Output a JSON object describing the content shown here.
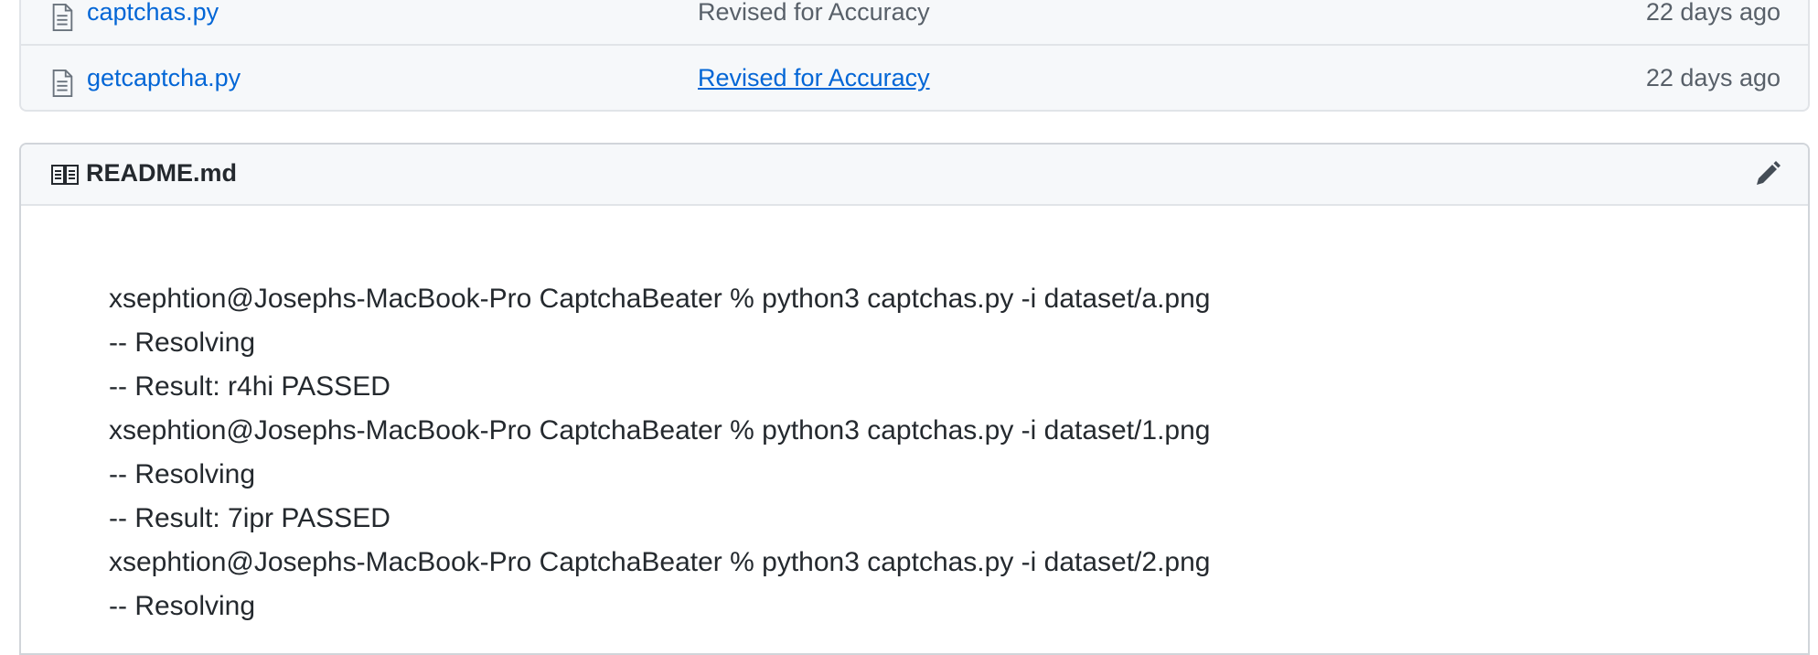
{
  "files": [
    {
      "name": "captchas.py",
      "icon": "file-icon",
      "commit_message": "Revised for Accuracy",
      "age": "22 days ago"
    },
    {
      "name": "getcaptcha.py",
      "icon": "file-icon",
      "commit_message": "Revised for Accuracy",
      "age": "22 days ago"
    }
  ],
  "readme": {
    "title": "README.md",
    "icon": "book-icon",
    "edit_icon": "pencil-icon",
    "lines": [
      "xsephtion@Josephs-MacBook-Pro CaptchaBeater % python3 captchas.py -i dataset/a.png",
      "-- Resolving",
      "-- Result: r4hi PASSED",
      "xsephtion@Josephs-MacBook-Pro CaptchaBeater % python3 captchas.py -i dataset/1.png",
      "-- Resolving",
      "-- Result: 7ipr PASSED",
      "xsephtion@Josephs-MacBook-Pro CaptchaBeater % python3 captchas.py -i dataset/2.png",
      "-- Resolving"
    ]
  },
  "colors": {
    "link": "#0366d6",
    "muted": "#586069",
    "text": "#24292e",
    "header_bg": "#f6f8fa",
    "border": "#e1e4e8"
  }
}
